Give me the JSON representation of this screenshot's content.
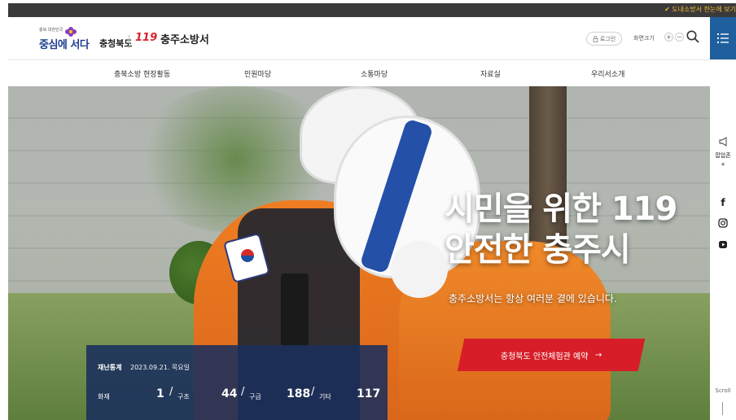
{
  "topbar": {
    "notice": "✔ 도내소방서 한눈에 보기"
  },
  "header": {
    "slogan_small": "충북 대한민국",
    "slogan_main": "중심에 서다",
    "province": "충청북도",
    "logo_119": "119",
    "station_name": "충주소방서",
    "login_label": "로그인",
    "zoom_label": "화면크기",
    "zoom_in": "+",
    "zoom_out": "−"
  },
  "nav": {
    "items": [
      {
        "label": "충북소방 현장활동"
      },
      {
        "label": "민원마당"
      },
      {
        "label": "소통마당"
      },
      {
        "label": "자료실"
      },
      {
        "label": "우리서소개"
      }
    ]
  },
  "hero": {
    "title_line1": "시민을 위한 119",
    "title_line2": "안전한 충주시",
    "subtitle": "충주소방서는 항상 여러분 곁에 있습니다.",
    "reserve_label": "충청북도 안전체험관 예약",
    "reserve_arrow": "→"
  },
  "stats": {
    "title": "재난통계",
    "date": "2023.09.21. 목요일",
    "items": [
      {
        "label": "화재",
        "value": "1"
      },
      {
        "label": "구조",
        "value": "44"
      },
      {
        "label": "구급",
        "value": "188"
      },
      {
        "label": "기타",
        "value": "117"
      }
    ],
    "separator": "/"
  },
  "rail": {
    "popup_label": "팝업존",
    "popup_plus": "+",
    "facebook": "f",
    "scroll_label": "Scroll"
  },
  "colors": {
    "brand_blue": "#1f5f9e",
    "accent_red": "#d71e28",
    "stats_bg": "#1a2f5c"
  }
}
